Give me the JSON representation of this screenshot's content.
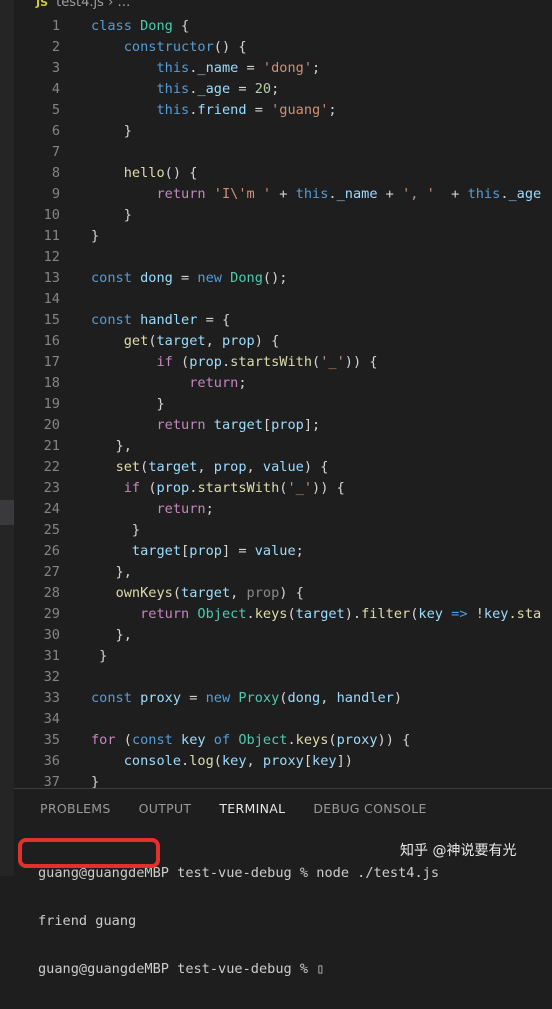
{
  "breadcrumb": {
    "file_icon": "JS",
    "file": "test4.js",
    "separator": "›",
    "more": "…"
  },
  "code": {
    "lines": [
      [
        [
          "class ",
          "kw"
        ],
        [
          "Dong",
          "cls"
        ],
        [
          " {",
          "pl"
        ]
      ],
      [
        [
          "    ",
          "pl"
        ],
        [
          "constructor",
          "kw"
        ],
        [
          "() {",
          "pl"
        ]
      ],
      [
        [
          "        ",
          "pl"
        ],
        [
          "this",
          "kw"
        ],
        [
          ".",
          "pl"
        ],
        [
          "_name",
          "var"
        ],
        [
          " = ",
          "pl"
        ],
        [
          "'dong'",
          "str"
        ],
        [
          ";",
          "pl"
        ]
      ],
      [
        [
          "        ",
          "pl"
        ],
        [
          "this",
          "kw"
        ],
        [
          ".",
          "pl"
        ],
        [
          "_age",
          "var"
        ],
        [
          " = ",
          "pl"
        ],
        [
          "20",
          "num"
        ],
        [
          ";",
          "pl"
        ]
      ],
      [
        [
          "        ",
          "pl"
        ],
        [
          "this",
          "kw"
        ],
        [
          ".",
          "pl"
        ],
        [
          "friend",
          "var"
        ],
        [
          " = ",
          "pl"
        ],
        [
          "'guang'",
          "str"
        ],
        [
          ";",
          "pl"
        ]
      ],
      [
        [
          "    }",
          "pl"
        ]
      ],
      [],
      [
        [
          "    ",
          "pl"
        ],
        [
          "hello",
          "fn"
        ],
        [
          "() {",
          "pl"
        ]
      ],
      [
        [
          "        ",
          "pl"
        ],
        [
          "return ",
          "ctl"
        ],
        [
          "'I\\'m '",
          "str"
        ],
        [
          " + ",
          "pl"
        ],
        [
          "this",
          "kw"
        ],
        [
          ".",
          "pl"
        ],
        [
          "_name",
          "var"
        ],
        [
          " + ",
          "pl"
        ],
        [
          "', '",
          "str"
        ],
        [
          "  + ",
          "pl"
        ],
        [
          "this",
          "kw"
        ],
        [
          ".",
          "pl"
        ],
        [
          "_age",
          "var"
        ]
      ],
      [
        [
          "    }",
          "pl"
        ]
      ],
      [
        [
          "}",
          "pl"
        ]
      ],
      [],
      [
        [
          "const ",
          "kw"
        ],
        [
          "dong",
          "var"
        ],
        [
          " = ",
          "pl"
        ],
        [
          "new ",
          "kw"
        ],
        [
          "Dong",
          "cls"
        ],
        [
          "();",
          "pl"
        ]
      ],
      [],
      [
        [
          "const ",
          "kw"
        ],
        [
          "handler",
          "var"
        ],
        [
          " = {",
          "pl"
        ]
      ],
      [
        [
          "    ",
          "pl"
        ],
        [
          "get",
          "fn"
        ],
        [
          "(",
          "pl"
        ],
        [
          "target",
          "var"
        ],
        [
          ", ",
          "pl"
        ],
        [
          "prop",
          "var"
        ],
        [
          ") {",
          "pl"
        ]
      ],
      [
        [
          "        ",
          "pl"
        ],
        [
          "if ",
          "ctl"
        ],
        [
          "(",
          "pl"
        ],
        [
          "prop",
          "var"
        ],
        [
          ".",
          "pl"
        ],
        [
          "startsWith",
          "fn"
        ],
        [
          "(",
          "pl"
        ],
        [
          "'_'",
          "str"
        ],
        [
          ")) {",
          "pl"
        ]
      ],
      [
        [
          "            ",
          "pl"
        ],
        [
          "return",
          "ctl"
        ],
        [
          ";",
          "pl"
        ]
      ],
      [
        [
          "        }",
          "pl"
        ]
      ],
      [
        [
          "        ",
          "pl"
        ],
        [
          "return ",
          "ctl"
        ],
        [
          "target",
          "var"
        ],
        [
          "[",
          "pl"
        ],
        [
          "prop",
          "var"
        ],
        [
          "];",
          "pl"
        ]
      ],
      [
        [
          "   },",
          "pl"
        ]
      ],
      [
        [
          "   ",
          "pl"
        ],
        [
          "set",
          "fn"
        ],
        [
          "(",
          "pl"
        ],
        [
          "target",
          "var"
        ],
        [
          ", ",
          "pl"
        ],
        [
          "prop",
          "var"
        ],
        [
          ", ",
          "pl"
        ],
        [
          "value",
          "var"
        ],
        [
          ") {",
          "pl"
        ]
      ],
      [
        [
          "    ",
          "pl"
        ],
        [
          "if ",
          "ctl"
        ],
        [
          "(",
          "pl"
        ],
        [
          "prop",
          "var"
        ],
        [
          ".",
          "pl"
        ],
        [
          "startsWith",
          "fn"
        ],
        [
          "(",
          "pl"
        ],
        [
          "'_'",
          "str"
        ],
        [
          ")) {",
          "pl"
        ]
      ],
      [
        [
          "        ",
          "pl"
        ],
        [
          "return",
          "ctl"
        ],
        [
          ";",
          "pl"
        ]
      ],
      [
        [
          "     }",
          "pl"
        ]
      ],
      [
        [
          "     ",
          "pl"
        ],
        [
          "target",
          "var"
        ],
        [
          "[",
          "pl"
        ],
        [
          "prop",
          "var"
        ],
        [
          "] = ",
          "pl"
        ],
        [
          "value",
          "var"
        ],
        [
          ";",
          "pl"
        ]
      ],
      [
        [
          "   },",
          "pl"
        ]
      ],
      [
        [
          "   ",
          "pl"
        ],
        [
          "ownKeys",
          "fn"
        ],
        [
          "(",
          "pl"
        ],
        [
          "target",
          "var"
        ],
        [
          ", ",
          "pl"
        ],
        [
          "prop",
          "dim"
        ],
        [
          ") {",
          "pl"
        ]
      ],
      [
        [
          "      ",
          "pl"
        ],
        [
          "return ",
          "ctl"
        ],
        [
          "Object",
          "cls"
        ],
        [
          ".",
          "pl"
        ],
        [
          "keys",
          "fn"
        ],
        [
          "(",
          "pl"
        ],
        [
          "target",
          "var"
        ],
        [
          ").",
          "pl"
        ],
        [
          "filter",
          "fn"
        ],
        [
          "(",
          "pl"
        ],
        [
          "key",
          "var"
        ],
        [
          " => ",
          "kw"
        ],
        [
          "!",
          "pl"
        ],
        [
          "key",
          "var"
        ],
        [
          ".sta",
          "fn"
        ]
      ],
      [
        [
          "   },",
          "pl"
        ]
      ],
      [
        [
          " }",
          "pl"
        ]
      ],
      [],
      [
        [
          "const ",
          "kw"
        ],
        [
          "proxy",
          "var"
        ],
        [
          " = ",
          "pl"
        ],
        [
          "new ",
          "kw"
        ],
        [
          "Proxy",
          "cls"
        ],
        [
          "(",
          "pl"
        ],
        [
          "dong",
          "var"
        ],
        [
          ", ",
          "pl"
        ],
        [
          "handler",
          "var"
        ],
        [
          ")",
          "pl"
        ]
      ],
      [],
      [
        [
          "for ",
          "ctl"
        ],
        [
          "(",
          "pl"
        ],
        [
          "const ",
          "kw"
        ],
        [
          "key",
          "var"
        ],
        [
          " of ",
          "kw"
        ],
        [
          "Object",
          "cls"
        ],
        [
          ".",
          "pl"
        ],
        [
          "keys",
          "fn"
        ],
        [
          "(",
          "pl"
        ],
        [
          "proxy",
          "var"
        ],
        [
          ")) {",
          "pl"
        ]
      ],
      [
        [
          "    ",
          "pl"
        ],
        [
          "console",
          "var"
        ],
        [
          ".",
          "pl"
        ],
        [
          "log",
          "fn"
        ],
        [
          "(",
          "pl"
        ],
        [
          "key",
          "var"
        ],
        [
          ", ",
          "pl"
        ],
        [
          "proxy",
          "var"
        ],
        [
          "[",
          "pl"
        ],
        [
          "key",
          "var"
        ],
        [
          "])",
          "pl"
        ]
      ],
      [
        [
          "}",
          "pl"
        ]
      ]
    ]
  },
  "panel": {
    "tabs": [
      "PROBLEMS",
      "OUTPUT",
      "TERMINAL",
      "DEBUG CONSOLE"
    ],
    "active_tab": "TERMINAL",
    "terminal": [
      "guang@guangdeMBP test-vue-debug % node ./test4.js",
      "friend guang",
      "guang@guangdeMBP test-vue-debug % ▯"
    ]
  },
  "watermark": "知乎 @神说要有光",
  "colors": {
    "background": "#1e1e1e",
    "highlight_circle": "#e0322b"
  }
}
